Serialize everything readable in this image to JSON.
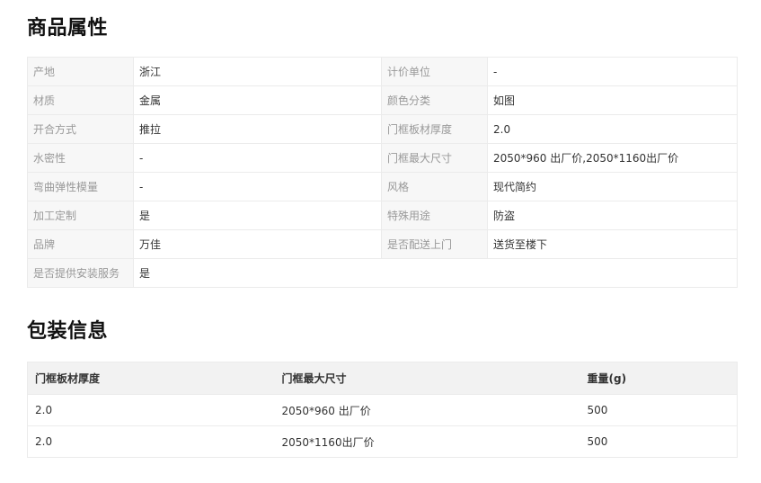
{
  "attributes_section": {
    "title": "商品属性",
    "rows": [
      {
        "l1": "产地",
        "v1": "浙江",
        "l2": "计价单位",
        "v2": "-"
      },
      {
        "l1": "材质",
        "v1": "金属",
        "l2": "颜色分类",
        "v2": "如图"
      },
      {
        "l1": "开合方式",
        "v1": "推拉",
        "l2": "门框板材厚度",
        "v2": "2.0"
      },
      {
        "l1": "水密性",
        "v1": "-",
        "l2": "门框最大尺寸",
        "v2": "2050*960 出厂价,2050*1160出厂价"
      },
      {
        "l1": "弯曲弹性模量",
        "v1": "-",
        "l2": "风格",
        "v2": "现代简约"
      },
      {
        "l1": "加工定制",
        "v1": "是",
        "l2": "特殊用途",
        "v2": "防盗"
      },
      {
        "l1": "品牌",
        "v1": "万佳",
        "l2": "是否配送上门",
        "v2": "送货至楼下"
      },
      {
        "l1": "是否提供安装服务",
        "v1": "是"
      }
    ]
  },
  "packaging_section": {
    "title": "包装信息",
    "headers": [
      "门框板材厚度",
      "门框最大尺寸",
      "重量(g)"
    ],
    "rows": [
      [
        "2.0",
        "2050*960 出厂价",
        "500"
      ],
      [
        "2.0",
        "2050*1160出厂价",
        "500"
      ]
    ]
  }
}
